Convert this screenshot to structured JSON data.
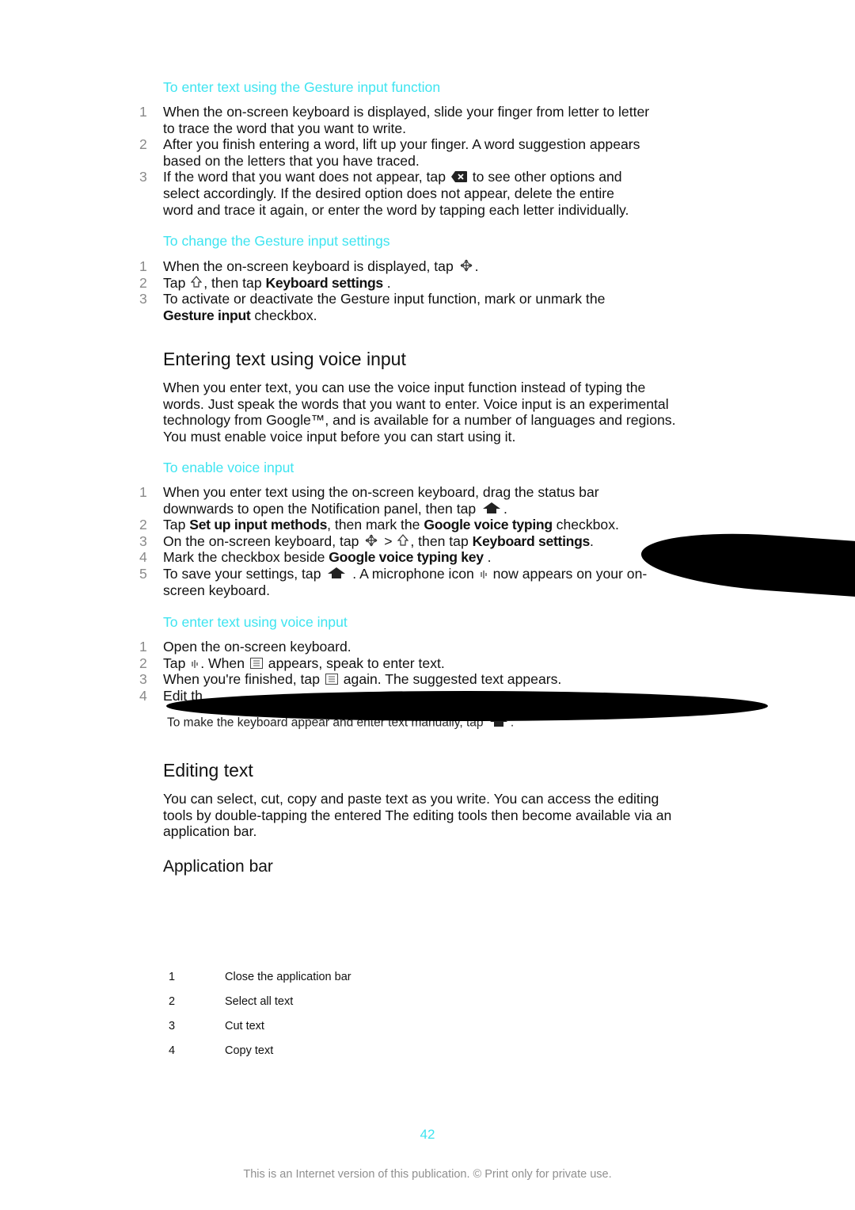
{
  "sections": {
    "gesture_enter": {
      "title": "To enter text using the Gesture input function",
      "steps": [
        {
          "n": "1",
          "lines": [
            [
              "When the on-screen keyboard is displayed, slide your finger from letter to letter"
            ],
            [
              "to trace the word that you want to write."
            ]
          ]
        },
        {
          "n": "2",
          "lines": [
            [
              "After you finish entering a word, lift up your finger. A word suggestion appears"
            ],
            [
              "based on the letters that you have traced."
            ]
          ]
        },
        {
          "n": "3",
          "lines": [
            [
              "If the word that you want does not appear, tap ",
              {
                "icon": "backspace"
              },
              " to see other options and"
            ],
            [
              "select accordingly. If the desired option does not appear, delete the entire"
            ],
            [
              "word and trace it again, or enter the word by tapping each letter individually."
            ]
          ]
        }
      ]
    },
    "gesture_settings": {
      "title": "To change the Gesture input settings",
      "steps": [
        {
          "n": "1",
          "lines": [
            [
              "When the on-screen keyboard is displayed, tap ",
              {
                "icon": "move"
              },
              "."
            ]
          ]
        },
        {
          "n": "2",
          "lines": [
            [
              "Tap ",
              {
                "icon": "shift"
              },
              ", then tap ",
              {
                "b": "Keyboard settings"
              },
              " ."
            ]
          ]
        },
        {
          "n": "3",
          "lines": [
            [
              "To activate or deactivate the Gesture input function, mark or unmark the"
            ],
            [
              {
                "b": "Gesture input"
              },
              " checkbox."
            ]
          ]
        }
      ]
    },
    "voice_heading": "Entering text using voice input",
    "voice_intro": [
      [
        [
          "When you enter text, you can use the voice input function instead of typing the"
        ]
      ],
      [
        [
          "words. Just speak the words that you want to enter. Voice input is an experimental"
        ]
      ],
      [
        [
          "technology from Google™, and is available for a number of languages and regions."
        ]
      ],
      [
        [
          "You must enable voice input before you can start using it."
        ]
      ]
    ],
    "voice_enable": {
      "title": "To enable voice input",
      "steps": [
        {
          "n": "1",
          "lines": [
            [
              "When you enter text using the on-screen keyboard, drag the status bar"
            ],
            [
              "downwards to open the Notification panel, then tap ",
              {
                "icon": "home"
              },
              "."
            ]
          ]
        },
        {
          "n": "2",
          "lines": [
            [
              "Tap ",
              {
                "b": "Set up input methods"
              },
              ", then mark the ",
              {
                "b": "Google voice typing"
              },
              " checkbox."
            ]
          ]
        },
        {
          "n": "3",
          "lines": [
            [
              "On the on-screen keyboard, tap ",
              {
                "icon": "move"
              },
              " > ",
              {
                "icon": "shift"
              },
              ", then tap ",
              {
                "b": "Keyboard settings"
              },
              "."
            ]
          ]
        },
        {
          "n": "4",
          "lines": [
            [
              "Mark the checkbox beside ",
              {
                "b": "Google voice typing key"
              },
              " ."
            ]
          ]
        },
        {
          "n": "5",
          "lines": [
            [
              "To save your settings, tap ",
              {
                "icon": "home"
              },
              " . A microphone icon ",
              {
                "icon": "mic"
              },
              " now appears on your on-"
            ],
            [
              "screen keyboard."
            ]
          ]
        }
      ]
    },
    "voice_enter": {
      "title": "To enter text using voice input",
      "steps": [
        {
          "n": "1",
          "lines": [
            [
              "Open the on-screen keyboard."
            ]
          ]
        },
        {
          "n": "2",
          "lines": [
            [
              "Tap ",
              {
                "icon": "mic"
              },
              ". When ",
              {
                "icon": "keyboard"
              },
              " appears, speak to enter text."
            ]
          ]
        },
        {
          "n": "3",
          "lines": [
            [
              "When you're finished, tap ",
              {
                "icon": "keyboard"
              },
              " again. The suggested text appears."
            ]
          ]
        },
        {
          "n": "4",
          "lines": [
            [
              "Edit th"
            ]
          ]
        }
      ],
      "note": "To make the keyboard appear and enter text manually, tap"
    },
    "editing_heading": "Editing text",
    "editing_intro": [
      [
        [
          "You can select, cut, copy and paste text as you write. You can access the editing"
        ]
      ],
      [
        [
          "tools by double-tapping the entered The editing tools then become available via an"
        ]
      ],
      [
        [
          "application bar."
        ]
      ]
    ],
    "appbar": {
      "title": "Application bar",
      "rows": [
        {
          "n": "1",
          "label": "Close the application bar"
        },
        {
          "n": "2",
          "label": "Select all text"
        },
        {
          "n": "3",
          "label": "Cut text"
        },
        {
          "n": "4",
          "label": "Copy text"
        }
      ]
    }
  },
  "footer": {
    "page_number": "42",
    "notice": "This is an Internet version of this publication. © Print only for private use."
  },
  "colors": {
    "subheading": "#3ee4f0",
    "text": "#111111",
    "step_number": "#8a8a8a",
    "redaction": "#000000"
  }
}
